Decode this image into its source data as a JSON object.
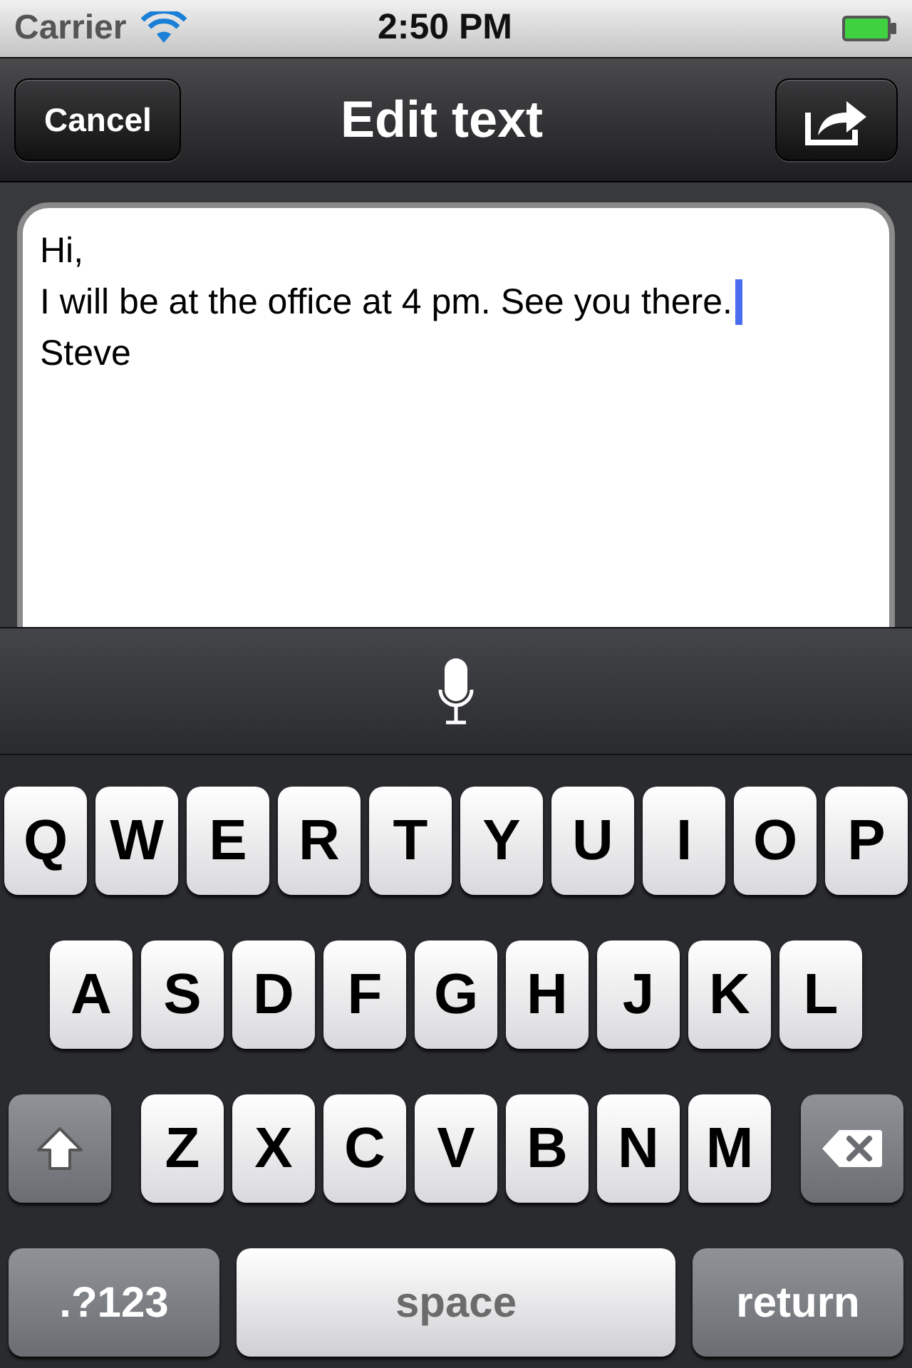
{
  "status_bar": {
    "carrier": "Carrier",
    "time": "2:50 PM"
  },
  "nav_bar": {
    "cancel": "Cancel",
    "title": "Edit text"
  },
  "text_field": {
    "lines": [
      {
        "text": "Hi,",
        "cursor": false
      },
      {
        "text": "I will be at the office at 4 pm. See you there.",
        "cursor": true
      },
      {
        "text": "Steve",
        "cursor": false
      }
    ]
  },
  "keyboard": {
    "rows": [
      [
        {
          "kind": "letter",
          "label": "Q"
        },
        {
          "kind": "letter",
          "label": "W"
        },
        {
          "kind": "letter",
          "label": "E"
        },
        {
          "kind": "letter",
          "label": "R"
        },
        {
          "kind": "letter",
          "label": "T"
        },
        {
          "kind": "letter",
          "label": "Y"
        },
        {
          "kind": "letter",
          "label": "U"
        },
        {
          "kind": "letter",
          "label": "I"
        },
        {
          "kind": "letter",
          "label": "O"
        },
        {
          "kind": "letter",
          "label": "P"
        }
      ],
      [
        {
          "kind": "letter",
          "label": "A"
        },
        {
          "kind": "letter",
          "label": "S"
        },
        {
          "kind": "letter",
          "label": "D"
        },
        {
          "kind": "letter",
          "label": "F"
        },
        {
          "kind": "letter",
          "label": "G"
        },
        {
          "kind": "letter",
          "label": "H"
        },
        {
          "kind": "letter",
          "label": "J"
        },
        {
          "kind": "letter",
          "label": "K"
        },
        {
          "kind": "letter",
          "label": "L"
        }
      ],
      [
        {
          "kind": "shift"
        },
        {
          "kind": "letter",
          "label": "Z"
        },
        {
          "kind": "letter",
          "label": "X"
        },
        {
          "kind": "letter",
          "label": "C"
        },
        {
          "kind": "letter",
          "label": "V"
        },
        {
          "kind": "letter",
          "label": "B"
        },
        {
          "kind": "letter",
          "label": "N"
        },
        {
          "kind": "letter",
          "label": "M"
        },
        {
          "kind": "delete"
        }
      ]
    ],
    "bottom_row": {
      "numbers_key": ".?123",
      "space_key": "space",
      "return_key": "return"
    }
  }
}
